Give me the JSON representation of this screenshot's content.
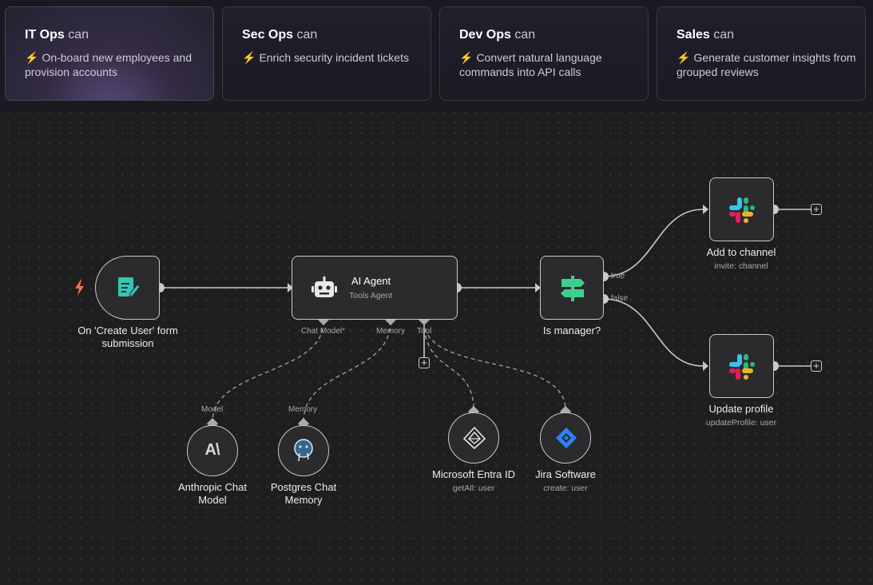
{
  "use_cases": [
    {
      "team": "IT Ops",
      "can": "can",
      "bolt": "⚡",
      "description": "On-board new employees and provision accounts"
    },
    {
      "team": "Sec Ops",
      "can": "can",
      "bolt": "⚡",
      "description": "Enrich security incident tickets"
    },
    {
      "team": "Dev Ops",
      "can": "can",
      "bolt": "⚡",
      "description": "Convert natural language commands into API calls"
    },
    {
      "team": "Sales",
      "can": "can",
      "bolt": "⚡",
      "description": "Generate customer insights from grouped reviews"
    }
  ],
  "workflow": {
    "trigger": {
      "label": "On 'Create User' form submission",
      "icon": "form-icon",
      "badge_icon": "lightning-icon"
    },
    "agent": {
      "title": "AI Agent",
      "subtitle": "Tools Agent",
      "icon": "robot-icon",
      "ports": {
        "chat_model": "Chat Model",
        "required_mark": "*",
        "memory": "Memory",
        "tool": "Tool"
      }
    },
    "if_node": {
      "label": "Is manager?",
      "icon": "signpost-icon",
      "true_label": "true",
      "false_label": "false"
    },
    "slack_add": {
      "label": "Add to channel",
      "sub": "invite: channel",
      "icon": "slack-icon"
    },
    "slack_update": {
      "label": "Update profile",
      "sub": "updateProfile: user",
      "icon": "slack-icon"
    },
    "anthropic": {
      "port": "Model",
      "label": "Anthropic Chat Model",
      "icon": "anthropic-icon",
      "icon_text": "A\\"
    },
    "postgres": {
      "port": "Memory",
      "label": "Postgres Chat Memory",
      "icon": "postgres-icon"
    },
    "entra": {
      "label": "Microsoft Entra ID",
      "sub": "getAll: user",
      "icon": "entra-icon"
    },
    "jira": {
      "label": "Jira Software",
      "sub": "create: user",
      "icon": "jira-icon"
    },
    "plus_symbol": "+"
  },
  "colors": {
    "accent_teal": "#35c6b4",
    "accent_green": "#3ecf8e",
    "trigger_bolt": "#ff6d5a",
    "jira_blue": "#2684ff"
  }
}
